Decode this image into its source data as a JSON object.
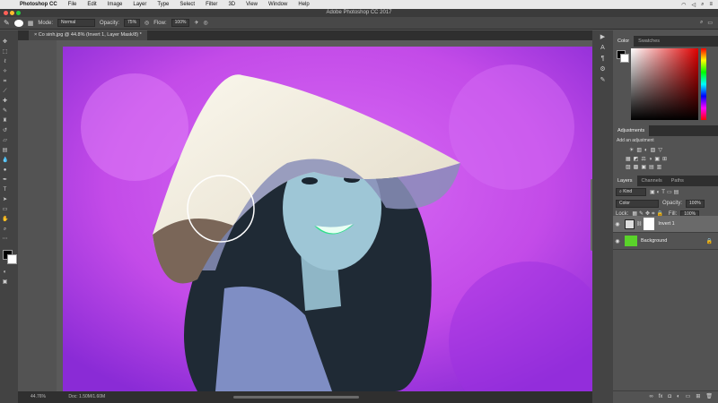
{
  "menubar": {
    "items": [
      "Photoshop CC",
      "File",
      "Edit",
      "Image",
      "Layer",
      "Type",
      "Select",
      "Filter",
      "3D",
      "View",
      "Window",
      "Help"
    ]
  },
  "window_title": "Adobe Photoshop CC 2017",
  "options": {
    "mode_label": "Mode:",
    "mode_value": "Normal",
    "opacity_label": "Opacity:",
    "opacity_value": "75%",
    "flow_label": "Flow:",
    "flow_value": "100%"
  },
  "document": {
    "tab_title": "Co sinh.jpg @ 44.8% (Invert 1, Layer Mask/8) *"
  },
  "status": {
    "zoom": "44.76%",
    "doc": "Doc: 1.50M/1.60M"
  },
  "color_panel": {
    "tabs": [
      "Color",
      "Swatches"
    ]
  },
  "adjustments_panel": {
    "title": "Adjustments",
    "subtitle": "Add an adjustment"
  },
  "layers_panel": {
    "tabs": [
      "Layers",
      "Channels",
      "Paths"
    ],
    "filter_label": "Kind",
    "blend_mode": "Color",
    "opacity_label": "Opacity:",
    "opacity_value": "100%",
    "lock_label": "Lock:",
    "fill_label": "Fill:",
    "fill_value": "100%",
    "layers": [
      {
        "name": "Invert 1"
      },
      {
        "name": "Background"
      }
    ]
  },
  "colors": {
    "canvas_bg": "#c94ef0",
    "hat": "#f2ede3",
    "skin": "#9ec6d6",
    "lips": "#2fe08a",
    "background_thumb": "#5ad32a"
  }
}
